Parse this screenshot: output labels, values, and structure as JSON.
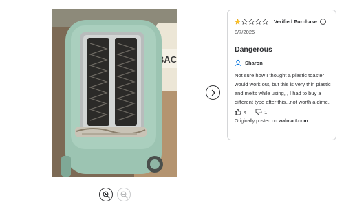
{
  "review": {
    "rating": 1,
    "max_rating": 5,
    "verified_label": "Verified Purchase",
    "date": "8/7/2025",
    "title": "Dangerous",
    "author": "Sharon",
    "body": "Not sure how I thought a plastic toaster would work out, but this is very thin plastic and melts while using, , I had to buy a different type after this...not worth a dime.",
    "helpful_count": "4",
    "unhelpful_count": "1",
    "source_prefix": "Originally posted on",
    "source_site": "walmart.com"
  },
  "colors": {
    "star_filled": "#ffc220",
    "star_empty": "#2e2f32",
    "toaster": "#9cc4b2"
  },
  "icons": {
    "info": "info-icon",
    "avatar": "user-icon",
    "thumbs_up": "thumbs-up-icon",
    "thumbs_down": "thumbs-down-icon",
    "zoom_in": "zoom-in-icon",
    "zoom_out": "zoom-out-icon",
    "next": "chevron-right-icon"
  }
}
